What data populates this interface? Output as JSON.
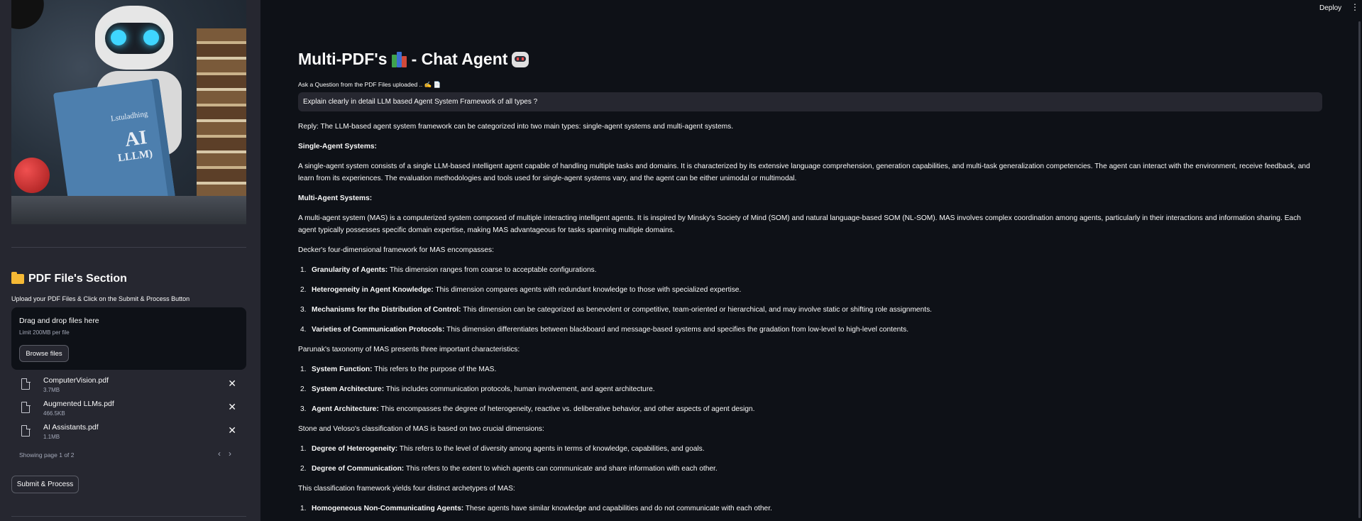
{
  "header": {
    "deploy_label": "Deploy",
    "menu_glyph": "⋮"
  },
  "sidebar": {
    "section_title": "PDF File's Section",
    "upload_label": "Upload your PDF Files & Click on the Submit & Process Button",
    "dropzone": {
      "title": "Drag and drop files here",
      "limit": "Limit 200MB per file",
      "browse_label": "Browse files"
    },
    "files": [
      {
        "name": "ComputerVision.pdf",
        "size": "3.7MB"
      },
      {
        "name": "Augmented LLMs.pdf",
        "size": "466.5KB"
      },
      {
        "name": "AI Assistants.pdf",
        "size": "1.1MB"
      }
    ],
    "pager_text": "Showing page 1 of 2",
    "submit_label": "Submit & Process",
    "hero_book_text": {
      "line1": "Lstuladhing",
      "line2": "AI",
      "line3": "LLLM)"
    }
  },
  "main": {
    "title_text": "Multi-PDF's",
    "title_suffix": "- Chat Agent",
    "subtitle": "Ask a Question from the PDF Files uploaded .. ✍️ 📄",
    "question": "Explain clearly in detail  LLM based Agent System Framework of all types ?",
    "answer": {
      "intro": "Reply: The LLM-based agent system framework can be categorized into two main types: single-agent systems and multi-agent systems.",
      "single_heading": "Single-Agent Systems:",
      "single_text": "A single-agent system consists of a single LLM-based intelligent agent capable of handling multiple tasks and domains. It is characterized by its extensive language comprehension, generation capabilities, and multi-task generalization competencies. The agent can interact with the environment, receive feedback, and learn from its experiences. The evaluation methodologies and tools used for single-agent systems vary, and the agent can be either unimodal or multimodal.",
      "multi_heading": "Multi-Agent Systems:",
      "multi_text": "A multi-agent system (MAS) is a computerized system composed of multiple interacting intelligent agents. It is inspired by Minsky's Society of Mind (SOM) and natural language-based SOM (NL-SOM). MAS involves complex coordination among agents, particularly in their interactions and information sharing. Each agent typically possesses specific domain expertise, making MAS advantageous for tasks spanning multiple domains.",
      "decker_intro": "Decker's four-dimensional framework for MAS encompasses:",
      "decker_items": [
        {
          "num": "1.",
          "term": "Granularity of Agents:",
          "desc": " This dimension ranges from coarse to acceptable configurations."
        },
        {
          "num": "2.",
          "term": "Heterogeneity in Agent Knowledge:",
          "desc": " This dimension compares agents with redundant knowledge to those with specialized expertise."
        },
        {
          "num": "3.",
          "term": "Mechanisms for the Distribution of Control:",
          "desc": " This dimension can be categorized as benevolent or competitive, team-oriented or hierarchical, and may involve static or shifting role assignments."
        },
        {
          "num": "4.",
          "term": "Varieties of Communication Protocols:",
          "desc": " This dimension differentiates between blackboard and message-based systems and specifies the gradation from low-level to high-level contents."
        }
      ],
      "parunak_intro": "Parunak's taxonomy of MAS presents three important characteristics:",
      "parunak_items": [
        {
          "num": "1.",
          "term": "System Function:",
          "desc": " This refers to the purpose of the MAS."
        },
        {
          "num": "2.",
          "term": "System Architecture:",
          "desc": " This includes communication protocols, human involvement, and agent architecture."
        },
        {
          "num": "3.",
          "term": "Agent Architecture:",
          "desc": " This encompasses the degree of heterogeneity, reactive vs. deliberative behavior, and other aspects of agent design."
        }
      ],
      "stone_intro": "Stone and Veloso's classification of MAS is based on two crucial dimensions:",
      "stone_items": [
        {
          "num": "1.",
          "term": "Degree of Heterogeneity:",
          "desc": " This refers to the level of diversity among agents in terms of knowledge, capabilities, and goals."
        },
        {
          "num": "2.",
          "term": "Degree of Communication:",
          "desc": " This refers to the extent to which agents can communicate and share information with each other."
        }
      ],
      "archetypes_intro": "This classification framework yields four distinct archetypes of MAS:",
      "archetype_items": [
        {
          "num": "1.",
          "term": "Homogeneous Non-Communicating Agents:",
          "desc": " These agents have similar knowledge and capabilities and do not communicate with each other."
        }
      ]
    }
  }
}
